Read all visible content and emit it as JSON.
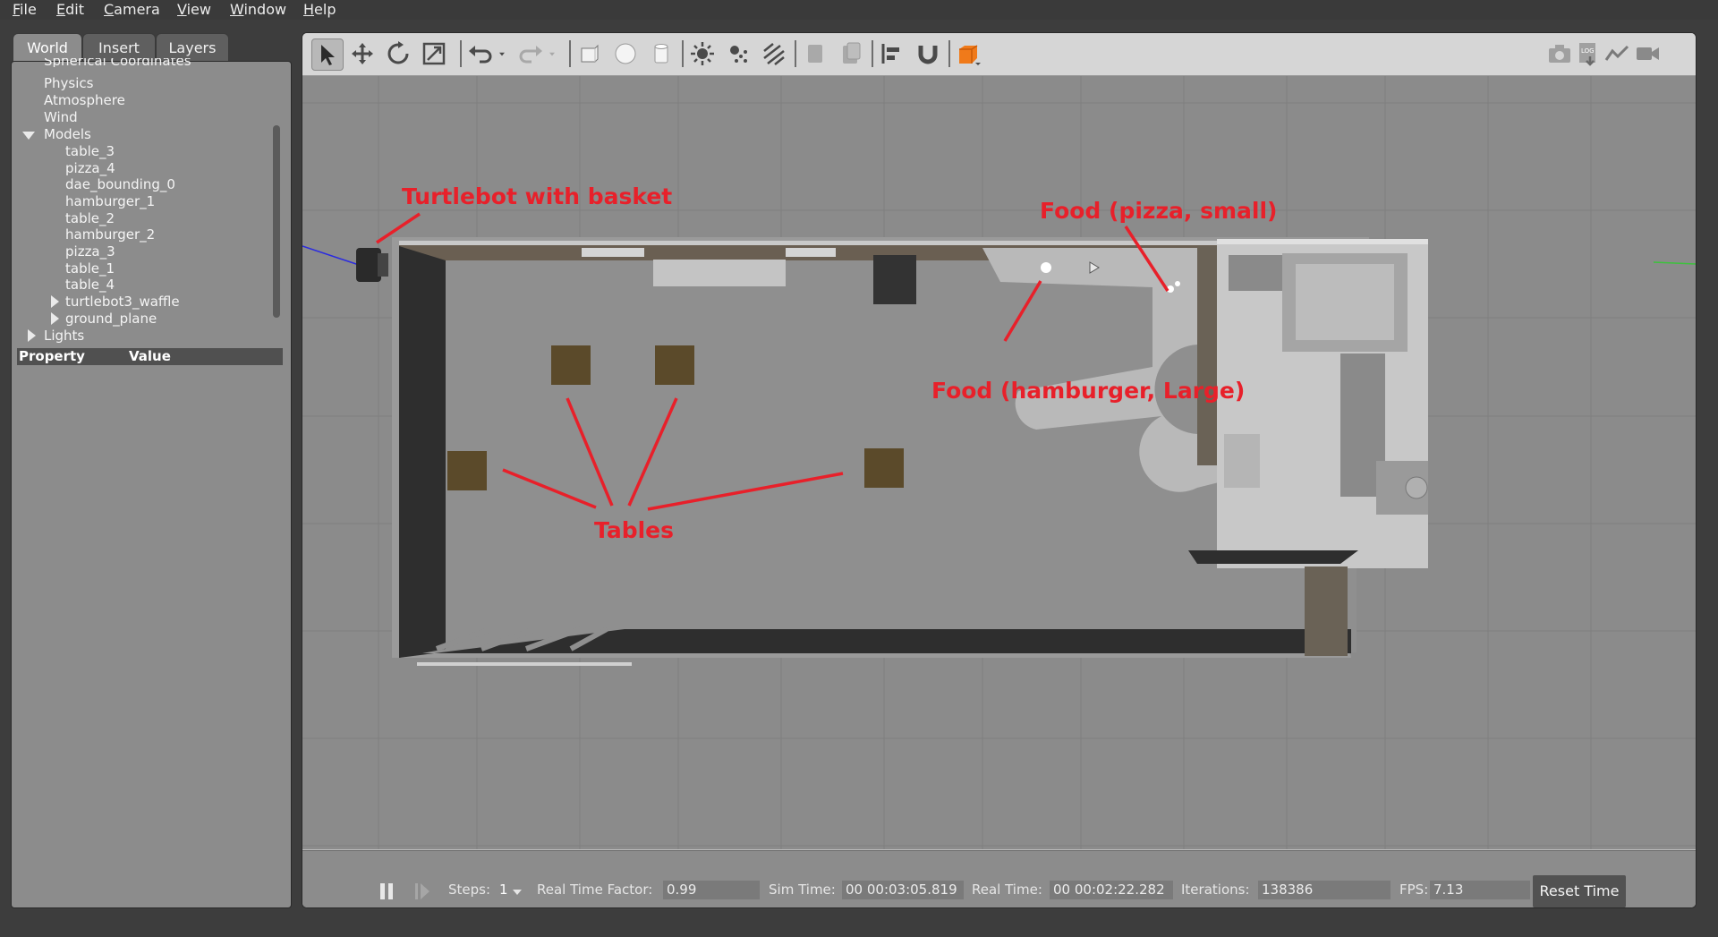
{
  "menu": {
    "file": "File",
    "edit": "Edit",
    "camera": "Camera",
    "view": "View",
    "window": "Window",
    "help": "Help"
  },
  "left_panel": {
    "tabs": {
      "world": "World",
      "insert": "Insert",
      "layers": "Layers"
    },
    "tree": {
      "spherical": "Spherical Coordinates",
      "physics": "Physics",
      "atmosphere": "Atmosphere",
      "wind": "Wind",
      "models": "Models",
      "model_items": [
        "table_3",
        "pizza_4",
        "dae_bounding_0",
        "hamburger_1",
        "table_2",
        "hamburger_2",
        "pizza_3",
        "table_1",
        "table_4"
      ],
      "turtlebot": "turtlebot3_waffle",
      "ground_plane": "ground_plane",
      "lights": "Lights"
    },
    "properties": {
      "property": "Property",
      "value": "Value"
    }
  },
  "toolbar": {
    "icons": [
      "select-arrow",
      "translate",
      "rotate",
      "scale",
      "undo",
      "redo",
      "box",
      "sphere",
      "cylinder",
      "point-light",
      "spot-light",
      "directional-light",
      "copy",
      "paste",
      "align",
      "snap",
      "view-angle",
      "screenshot",
      "log",
      "plot",
      "record"
    ]
  },
  "annotations": {
    "turtlebot": "Turtlebot with basket",
    "pizza": "Food (pizza, small)",
    "hamburger": "Food (hamburger, Large)",
    "tables": "Tables"
  },
  "bottom_bar": {
    "steps_label": "Steps:",
    "steps_value": "1",
    "rtf_label": "Real Time Factor:",
    "rtf_value": "0.99",
    "sim_time_label": "Sim Time:",
    "sim_time_value": "00 00:03:05.819",
    "real_time_label": "Real Time:",
    "real_time_value": "00 00:02:22.282",
    "iterations_label": "Iterations:",
    "iterations_value": "138386",
    "fps_label": "FPS:",
    "fps_value": "7.13",
    "reset_label": "Reset Time"
  },
  "colors": {
    "annotation_red": "#e8202a",
    "table_brown": "#5b4a2a",
    "wall_dark": "#2e2e2e",
    "floor_gray": "#8b8b8b",
    "orange_accent": "#f07a1a"
  }
}
